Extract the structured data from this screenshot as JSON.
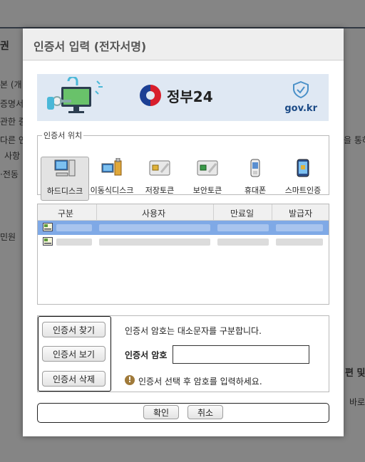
{
  "background": {
    "texts": [
      "권",
      "본 (개",
      "증명서",
      "관한 증",
      "다른 인",
      "사항",
      "·전동",
      "민원",
      "을 통하",
      "편 및",
      "바로"
    ]
  },
  "dialog": {
    "title": "인증서 입력 (전자서명)",
    "banner": {
      "logo_text": "정부24",
      "domain_text": "gov.kr"
    },
    "location": {
      "legend": "인증서 위치",
      "items": [
        {
          "label": "하드디스크",
          "icon": "hard-disk-icon",
          "selected": true
        },
        {
          "label": "이동식디스크",
          "icon": "removable-disk-icon",
          "selected": false
        },
        {
          "label": "저장토큰",
          "icon": "storage-token-icon",
          "selected": false
        },
        {
          "label": "보안토큰",
          "icon": "security-token-icon",
          "selected": false
        },
        {
          "label": "휴대폰",
          "icon": "mobile-phone-icon",
          "selected": false
        },
        {
          "label": "스마트인증",
          "icon": "smart-auth-icon",
          "selected": false
        }
      ]
    },
    "table": {
      "columns": [
        "구분",
        "사용자",
        "만료일",
        "발급자"
      ],
      "rows": [
        {
          "selected": true,
          "icon": "certificate-icon"
        },
        {
          "selected": false,
          "icon": "certificate-icon"
        }
      ]
    },
    "buttons": {
      "find": "인증서 찾기",
      "view": "인증서 보기",
      "delete": "인증서 삭제"
    },
    "password": {
      "notice": "인증서 암호는 대소문자를 구분합니다.",
      "label": "인증서 암호",
      "value": "",
      "hint": "인증서 선택 후 암호를 입력하세요."
    },
    "footer": {
      "confirm": "확인",
      "cancel": "취소"
    }
  },
  "colors": {
    "selection": "#7fa9e6",
    "banner_bg": "#dfe8f3",
    "gov_blue": "#1b4a86",
    "title_bg": "#eeeeee"
  }
}
